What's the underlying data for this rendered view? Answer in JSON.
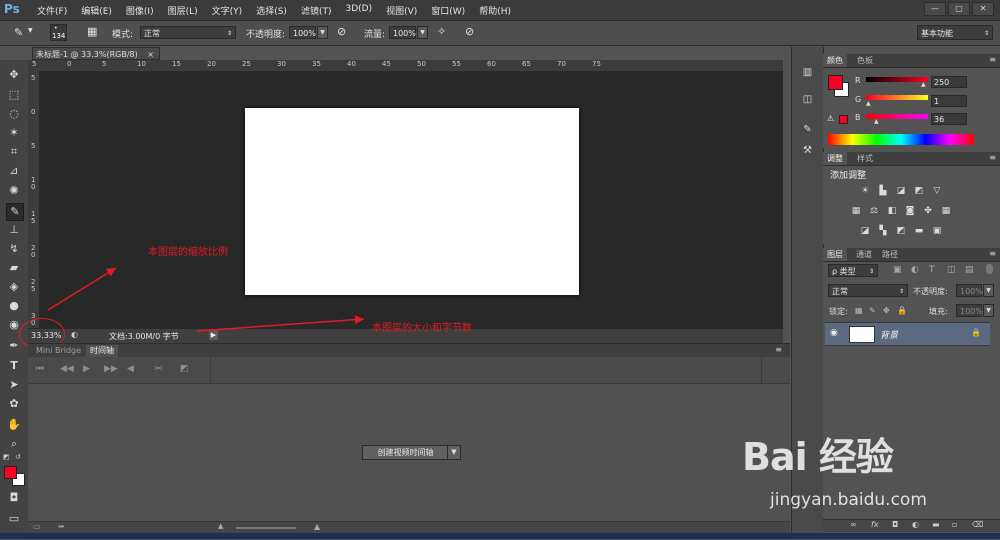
{
  "app": {
    "logo": "Ps"
  },
  "menu": [
    "文件(F)",
    "编辑(E)",
    "图像(I)",
    "图层(L)",
    "文字(Y)",
    "选择(S)",
    "滤镜(T)",
    "3D(D)",
    "视图(V)",
    "窗口(W)",
    "帮助(H)"
  ],
  "window_controls": {
    "minimize": "—",
    "restore": "▢",
    "close": "✕"
  },
  "options_bar": {
    "brush_size": "134",
    "mode_label": "模式:",
    "mode_value": "正常",
    "opacity_label": "不透明度:",
    "opacity_value": "100%",
    "flow_label": "流量:",
    "flow_value": "100%",
    "workspace": "基本功能"
  },
  "document_tab": {
    "title": "未标题-1 @ 33.3%(RGB/8)",
    "close": "×"
  },
  "ruler_top_ticks": [
    "5",
    "0",
    "5",
    "10",
    "15",
    "20",
    "25",
    "30",
    "35",
    "40",
    "45",
    "50",
    "55",
    "60",
    "65",
    "70",
    "75"
  ],
  "ruler_left_ticks": [
    "5",
    "0",
    "5",
    "1 0",
    "1 5",
    "2 0",
    "2 5",
    "3 0"
  ],
  "status": {
    "zoom": "33.33%",
    "doc_info": "文档:3.00M/0 字节"
  },
  "annotations": {
    "zoom_note": "本图层的缩放比例",
    "size_note": "本图层的大小和字节数"
  },
  "timeline": {
    "tabs": [
      "Mini Bridge",
      "时间轴"
    ],
    "create_button": "创建视频时间轴"
  },
  "color_panel": {
    "tabs": [
      "颜色",
      "色板"
    ],
    "r_label": "R",
    "r_value": "250",
    "g_label": "G",
    "g_value": "1",
    "b_label": "B",
    "b_value": "36",
    "foreground": "#fa0124"
  },
  "adjustments_panel": {
    "tabs": [
      "调整",
      "样式"
    ],
    "heading": "添加调整"
  },
  "layers_panel": {
    "tabs": [
      "图层",
      "通道",
      "路径"
    ],
    "filter_label": "ρ 类型",
    "blend_mode": "正常",
    "opacity_label": "不透明度:",
    "opacity_value": "100%",
    "lock_label": "锁定:",
    "fill_label": "填充:",
    "fill_value": "100%",
    "layer_name": "背景"
  },
  "watermark": {
    "main": "Bai 经验",
    "sub": "jingyan.baidu.com"
  },
  "colors": {
    "accent_red": "#e31b23",
    "canvas_bg": "#282828",
    "panel_bg": "#535353"
  }
}
